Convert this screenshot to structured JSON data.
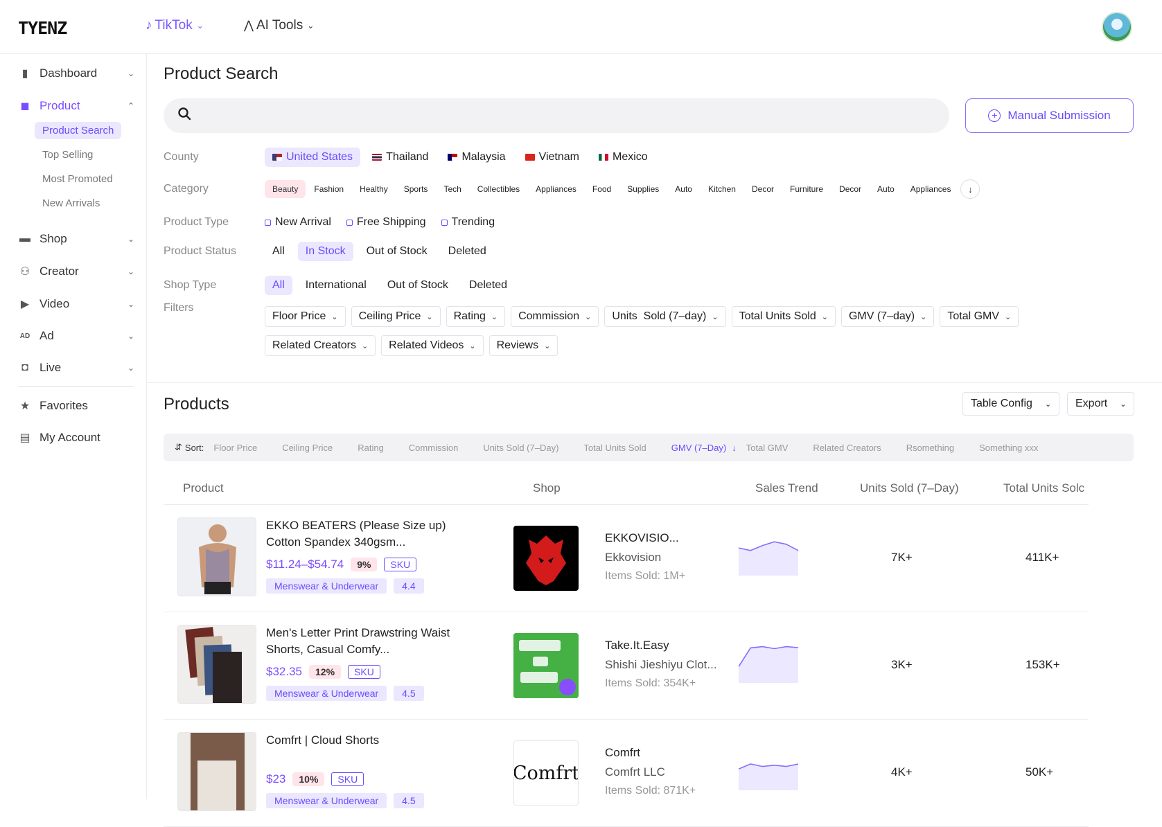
{
  "header": {
    "logo": "TYENZ",
    "platform": "TikTok",
    "ai_tools": "AI Tools"
  },
  "sidebar": {
    "dashboard": "Dashboard",
    "product": "Product",
    "sub": [
      "Product Search",
      "Top Selling",
      "Most Promoted",
      "New Arrivals"
    ],
    "shop": "Shop",
    "creator": "Creator",
    "video": "Video",
    "ad": "Ad",
    "live": "Live",
    "favorites": "Favorites",
    "account": "My Account"
  },
  "search": {
    "title": "Product Search",
    "placeholder": "",
    "manual_label": "Manual Submission"
  },
  "filters": {
    "county_label": "County",
    "countries": [
      "United States",
      "Thailand",
      "Malaysia",
      "Vietnam",
      "Mexico"
    ],
    "category_label": "Category",
    "categories": [
      "Beauty",
      "Fashion",
      "Healthy",
      "Sports",
      "Tech",
      "Collectibles",
      "Appliances",
      "Food",
      "Supplies",
      "Auto",
      "Kitchen",
      "Decor",
      "Furniture",
      "Decor",
      "Auto",
      "Appliances"
    ],
    "product_type_label": "Product Type",
    "product_types": [
      "New Arrival",
      "Free Shipping",
      "Trending"
    ],
    "product_status_label": "Product Status",
    "product_statuses": [
      "All",
      "In Stock",
      "Out of Stock",
      "Deleted"
    ],
    "shop_type_label": "Shop Type",
    "shop_types": [
      "All",
      "International",
      "Out of Stock",
      "Deleted"
    ],
    "filters_label": "Filters",
    "dropdowns_row1": [
      "Floor Price",
      "Ceiling Price",
      "Rating",
      "Commission",
      "Units  Sold (7–day)",
      "Total Units Sold",
      "GMV (7–day)",
      "Total GMV"
    ],
    "dropdowns_row2": [
      "Related Creators",
      "Related Videos",
      "Reviews"
    ]
  },
  "products": {
    "title": "Products",
    "table_config": "Table Config",
    "export": "Export",
    "sort_label": "Sort:",
    "sort_items": [
      "Floor Price",
      "Ceiling Price",
      "Rating",
      "Commission",
      "Units Sold (7–Day)",
      "Total Units Sold",
      "GMV (7–Day)",
      "Total GMV",
      "Related Creators",
      "Rsomething",
      "Something xxx"
    ],
    "sort_active": "GMV (7–Day)",
    "columns": [
      "Product",
      "Shop",
      "Sales Trend",
      "Units Sold (7–Day)",
      "Total Units Solc"
    ],
    "rows": [
      {
        "name": "EKKO BEATERS (Please Size up) Cotton Spandex 340gsm...",
        "price": "$11.24–$54.74",
        "commission": "9%",
        "sku": "SKU",
        "category": "Menswear & Underwear",
        "rating": "4.4",
        "shop_name": "EKKOVISIO...",
        "shop_sub": "Ekkovision",
        "shop_sold": "Items Sold: 1M+",
        "units_7d": "7K+",
        "total_units": "411K+",
        "trend": [
          0.45,
          0.55,
          0.35,
          0.2,
          0.3,
          0.55
        ]
      },
      {
        "name": "Men's Letter Print Drawstring Waist Shorts, Casual Comfy...",
        "price": "$32.35",
        "commission": "12%",
        "sku": "SKU",
        "category": "Menswear & Underwear",
        "rating": "4.5",
        "shop_name": "Take.It.Easy",
        "shop_sub": "Shishi Jieshiyu Clot...",
        "shop_sold": "Items Sold: 354K+",
        "units_7d": "3K+",
        "total_units": "153K+",
        "trend": [
          0.9,
          0.15,
          0.1,
          0.18,
          0.1,
          0.14
        ]
      },
      {
        "name": "Comfrt | Cloud Shorts",
        "price": "$23",
        "commission": "10%",
        "sku": "SKU",
        "category": "Menswear & Underwear",
        "rating": "4.5",
        "shop_name": "Comfrt",
        "shop_sub": "Comfrt LLC",
        "shop_sold": "Items Sold: 871K+",
        "shop_logo_text": "Comfrt",
        "units_7d": "4K+",
        "total_units": "50K+",
        "trend": [
          0.7,
          0.5,
          0.6,
          0.55,
          0.6,
          0.5
        ]
      }
    ]
  },
  "colors": {
    "accent": "#6a4cff",
    "chip_selected_bg": "#ebe7ff",
    "pink": "#ffe4ea"
  }
}
